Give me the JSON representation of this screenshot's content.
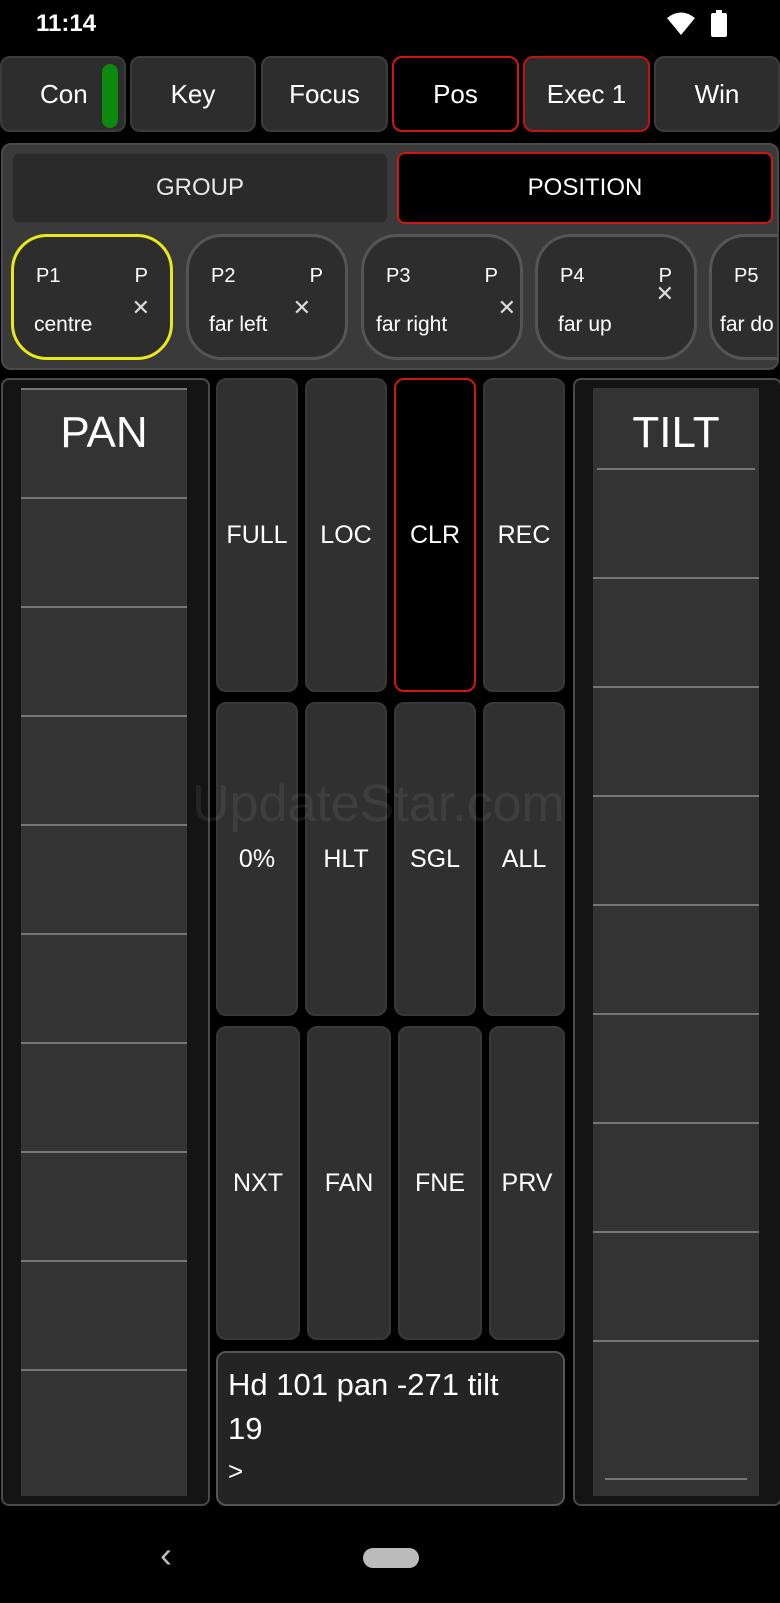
{
  "status": {
    "time": "11:14"
  },
  "tabs": [
    {
      "label": "Con",
      "indicator": "#0d8a0d"
    },
    {
      "label": "Key"
    },
    {
      "label": "Focus"
    },
    {
      "label": "Pos",
      "active": true
    },
    {
      "label": "Exec 1"
    },
    {
      "label": "Win"
    }
  ],
  "modes": {
    "group": "GROUP",
    "position": "POSITION"
  },
  "presets": [
    {
      "id": "P1",
      "flag": "P",
      "name": "centre",
      "selected": true
    },
    {
      "id": "P2",
      "flag": "P",
      "name": "far left"
    },
    {
      "id": "P3",
      "flag": "P",
      "name": "far right"
    },
    {
      "id": "P4",
      "flag": "P",
      "name": "far up"
    },
    {
      "id": "P5",
      "flag": "",
      "name": "far do"
    }
  ],
  "faders": {
    "pan": "PAN",
    "tilt": "TILT"
  },
  "keypad": {
    "row1": [
      "FULL",
      "LOC",
      "CLR",
      "REC"
    ],
    "row2": [
      "0%",
      "HLT",
      "SGL",
      "ALL"
    ],
    "row3": [
      "NXT",
      "FAN",
      "FNE",
      "PRV"
    ]
  },
  "command": {
    "line1": "Hd 101 pan -271 tilt",
    "line2": "19",
    "prompt": ">"
  },
  "watermark": "UpdateStar.com",
  "nav": {
    "back": "‹"
  },
  "colors": {
    "accent_red": "#d01616",
    "selected_yellow": "#e8e81a",
    "indicator_green": "#0d8a0d"
  }
}
